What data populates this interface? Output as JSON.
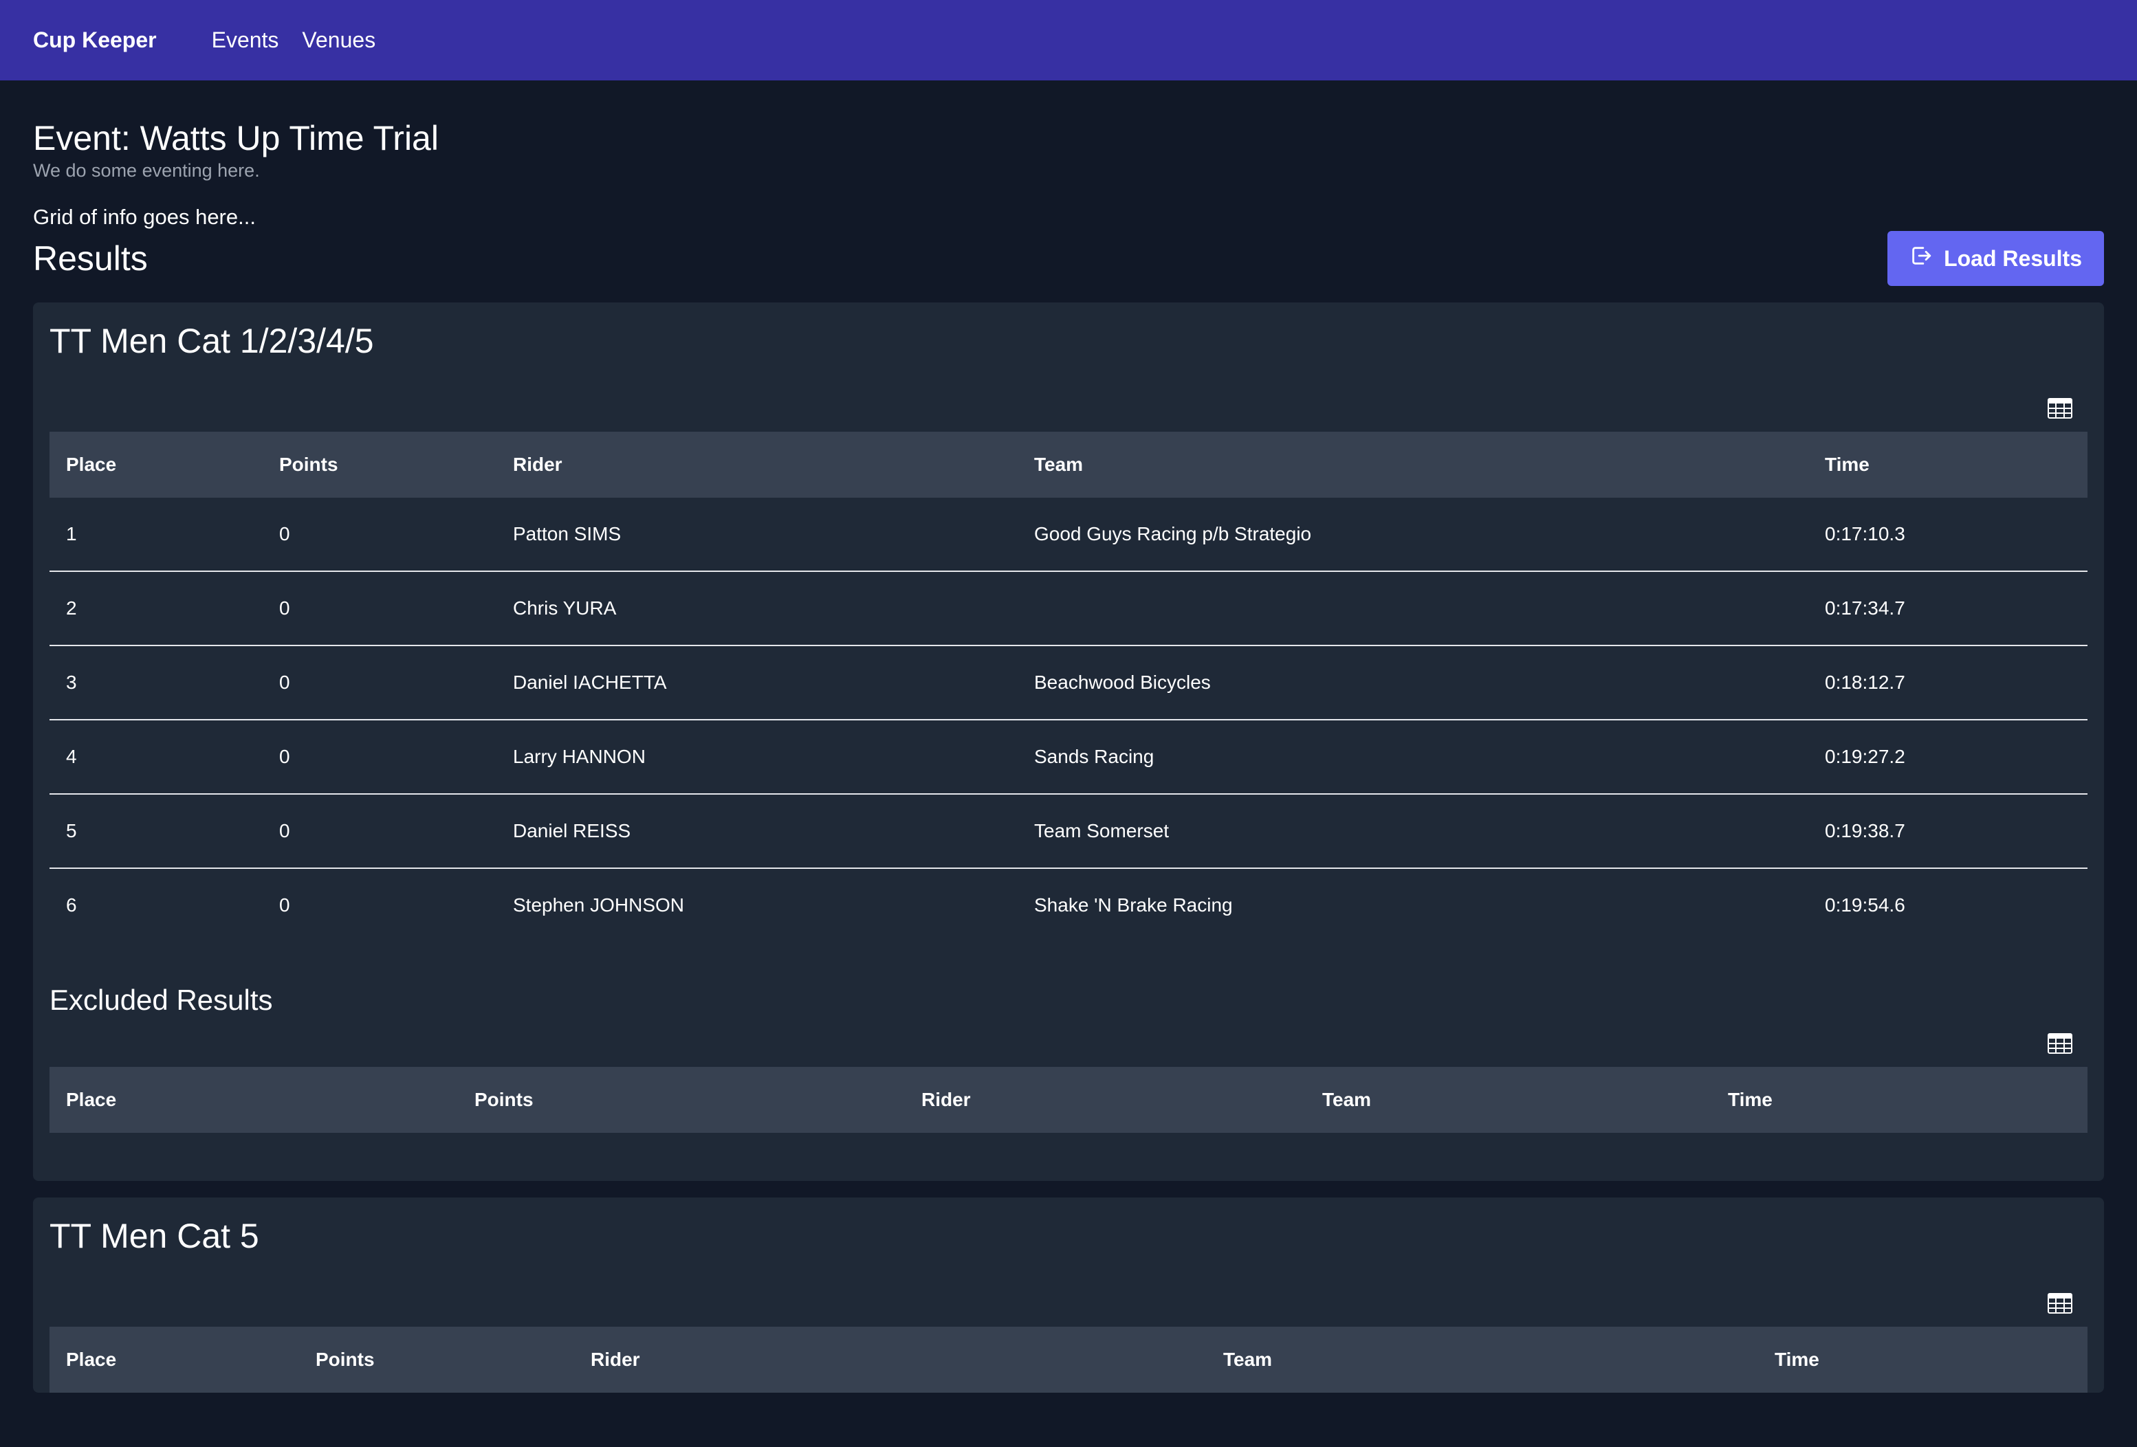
{
  "nav": {
    "brand": "Cup Keeper",
    "links": [
      "Events",
      "Venues"
    ]
  },
  "event": {
    "title": "Event: Watts Up Time Trial",
    "subtitle": "We do some eventing here.",
    "grid_info": "Grid of info goes here..."
  },
  "results": {
    "title": "Results",
    "load_button": "Load Results",
    "load_icon": "sign-in-icon",
    "table_icon": "table-icon"
  },
  "columns": [
    "Place",
    "Points",
    "Rider",
    "Team",
    "Time"
  ],
  "categories": [
    {
      "title": "TT Men Cat 1/2/3/4/5",
      "rows": [
        [
          "1",
          "0",
          "Patton SIMS",
          "Good Guys Racing p/b Strategio",
          "0:17:10.3"
        ],
        [
          "2",
          "0",
          "Chris YURA",
          "",
          "0:17:34.7"
        ],
        [
          "3",
          "0",
          "Daniel IACHETTA",
          "Beachwood Bicycles",
          "0:18:12.7"
        ],
        [
          "4",
          "0",
          "Larry HANNON",
          "Sands Racing",
          "0:19:27.2"
        ],
        [
          "5",
          "0",
          "Daniel REISS",
          "Team Somerset",
          "0:19:38.7"
        ],
        [
          "6",
          "0",
          "Stephen JOHNSON",
          "Shake 'N Brake Racing",
          "0:19:54.6"
        ]
      ],
      "excluded_title": "Excluded Results"
    },
    {
      "title": "TT Men Cat 5"
    }
  ],
  "colors": {
    "topbar": "#3730a3",
    "background": "#111827",
    "card": "#1f2937",
    "table_header": "#374151",
    "button": "#6366f1"
  }
}
